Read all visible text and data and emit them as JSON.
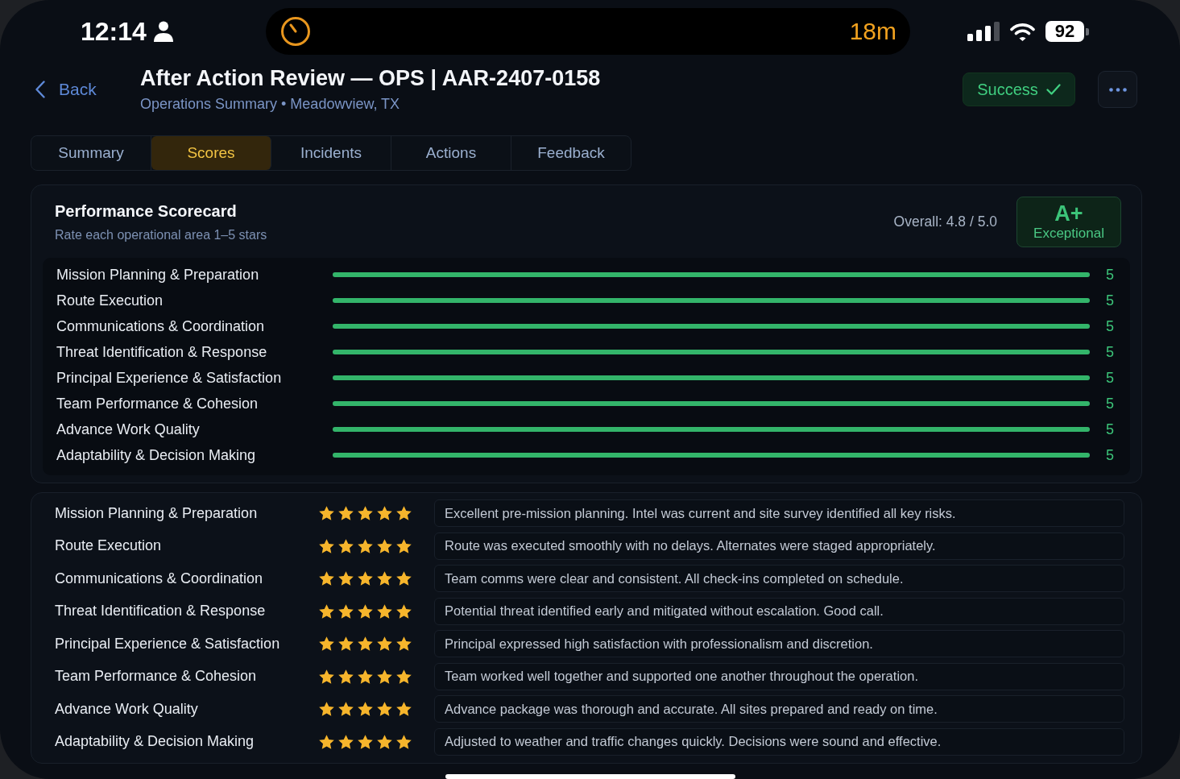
{
  "status_bar": {
    "time": "12:14",
    "timer": "18m",
    "battery": "92"
  },
  "header": {
    "back_label": "Back",
    "title": "After Action Review — OPS | AAR-2407-0158",
    "subtitle": "Operations Summary • Meadowview, TX",
    "status_button": "Success"
  },
  "tabs": [
    {
      "label": "Summary",
      "selected": false
    },
    {
      "label": "Scores",
      "selected": true
    },
    {
      "label": "Incidents",
      "selected": false
    },
    {
      "label": "Actions",
      "selected": false
    },
    {
      "label": "Feedback",
      "selected": false
    }
  ],
  "scorecard": {
    "title": "Performance Scorecard",
    "subtitle": "Rate each operational area 1–5 stars",
    "overall": "Overall: 4.8 / 5.0",
    "grade": "A+",
    "grade_label": "Exceptional",
    "bars": [
      {
        "name": "Mission Planning & Preparation",
        "level": 1,
        "score": "5"
      },
      {
        "name": "Route Execution",
        "level": 1,
        "score": "5"
      },
      {
        "name": "Communications & Coordination",
        "level": 1,
        "score": "5"
      },
      {
        "name": "Threat Identification & Response",
        "level": 1,
        "score": "5"
      },
      {
        "name": "Principal Experience & Satisfaction",
        "level": 1,
        "score": "5"
      },
      {
        "name": "Team Performance & Cohesion",
        "level": 1,
        "score": "5"
      },
      {
        "name": "Advance Work Quality",
        "level": 1,
        "score": "5"
      },
      {
        "name": "Adaptability & Decision Making",
        "level": 1,
        "score": "5"
      }
    ]
  },
  "ratings": [
    {
      "name": "Mission Planning & Preparation",
      "stars": 5,
      "comment": "Excellent pre-mission planning. Intel was current and site survey identified all key risks."
    },
    {
      "name": "Route Execution",
      "stars": 5,
      "comment": "Route was executed smoothly with no delays. Alternates were staged appropriately."
    },
    {
      "name": "Communications & Coordination",
      "stars": 5,
      "comment": "Team comms were clear and consistent. All check-ins completed on schedule."
    },
    {
      "name": "Threat Identification & Response",
      "stars": 5,
      "comment": "Potential threat identified early and mitigated without escalation. Good call."
    },
    {
      "name": "Principal Experience & Satisfaction",
      "stars": 5,
      "comment": "Principal expressed high satisfaction with professionalism and discretion."
    },
    {
      "name": "Team Performance & Cohesion",
      "stars": 5,
      "comment": "Team worked well together and supported one another throughout the operation."
    },
    {
      "name": "Advance Work Quality",
      "stars": 5,
      "comment": "Advance package was thorough and accurate. All sites prepared and ready on time."
    },
    {
      "name": "Adaptability & Decision Making",
      "stars": 5,
      "comment": "Adjusted to weather and traffic changes quickly. Decisions were sound and effective."
    }
  ]
}
